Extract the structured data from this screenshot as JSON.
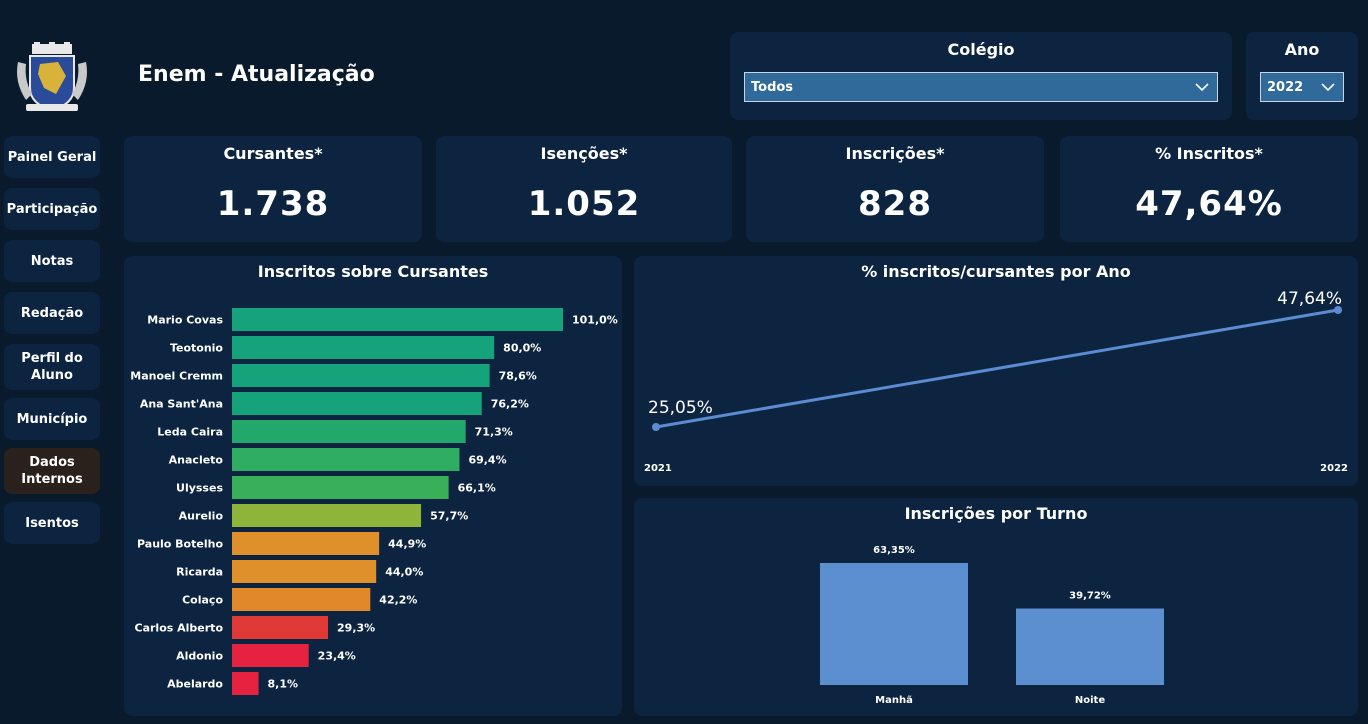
{
  "header": {
    "title": "Enem - Atualização"
  },
  "sidebar": {
    "items": [
      {
        "label": "Painel Geral"
      },
      {
        "label": "Participação"
      },
      {
        "label": "Notas"
      },
      {
        "label": "Redação"
      },
      {
        "label": "Perfil do Aluno"
      },
      {
        "label": "Município"
      },
      {
        "label": "Dados Internos",
        "active": true
      },
      {
        "label": "Isentos"
      }
    ]
  },
  "filters": {
    "colegio": {
      "title": "Colégio",
      "value": "Todos"
    },
    "ano": {
      "title": "Ano",
      "value": "2022"
    }
  },
  "kpis": [
    {
      "title": "Cursantes*",
      "value": "1.738"
    },
    {
      "title": "Isenções*",
      "value": "1.052"
    },
    {
      "title": "Inscrições*",
      "value": "828"
    },
    {
      "title": "% Inscritos*",
      "value": "47,64%"
    }
  ],
  "icons": {
    "logo": "municipal-coat-of-arms-icon",
    "dropdown": "chevron-down-icon"
  },
  "colors": {
    "background": "#081a2b",
    "panel": "#0d2440",
    "line": "#5b8bd0",
    "turno_bar": "#5b8fcf"
  },
  "chart_data": [
    {
      "type": "bar",
      "orientation": "horizontal",
      "title": "Inscritos sobre Cursantes",
      "categories": [
        "Mario Covas",
        "Teotonio",
        "Manoel Cremm",
        "Ana Sant'Ana",
        "Leda Caira",
        "Anacleto",
        "Ulysses",
        "Aurelio",
        "Paulo Botelho",
        "Ricarda",
        "Colaço",
        "Carlos Alberto",
        "Aldonio",
        "Abelardo"
      ],
      "values": [
        101.0,
        80.0,
        78.6,
        76.2,
        71.3,
        69.4,
        66.1,
        57.7,
        44.9,
        44.0,
        42.2,
        29.3,
        23.4,
        8.1
      ],
      "labels": [
        "101,0%",
        "80,0%",
        "78,6%",
        "76,2%",
        "71,3%",
        "69,4%",
        "66,1%",
        "57,7%",
        "44,9%",
        "44,0%",
        "42,2%",
        "29,3%",
        "23,4%",
        "8,1%"
      ],
      "colors": [
        "#14a37a",
        "#14a37a",
        "#14a37a",
        "#14a37a",
        "#22a86a",
        "#2fad62",
        "#3aaf5a",
        "#8fb43a",
        "#e0902a",
        "#e0902a",
        "#e0882a",
        "#e03a38",
        "#e52240",
        "#e52240"
      ]
    },
    {
      "type": "line",
      "title": "% inscritos/cursantes por Ano",
      "x": [
        "2021",
        "2022"
      ],
      "values": [
        25.05,
        47.64
      ],
      "labels": [
        "25,05%",
        "47,64%"
      ]
    },
    {
      "type": "bar",
      "title": "Inscrições por Turno",
      "categories": [
        "Manhã",
        "Noite"
      ],
      "values": [
        63.35,
        39.72
      ],
      "labels": [
        "63,35%",
        "39,72%"
      ]
    }
  ]
}
